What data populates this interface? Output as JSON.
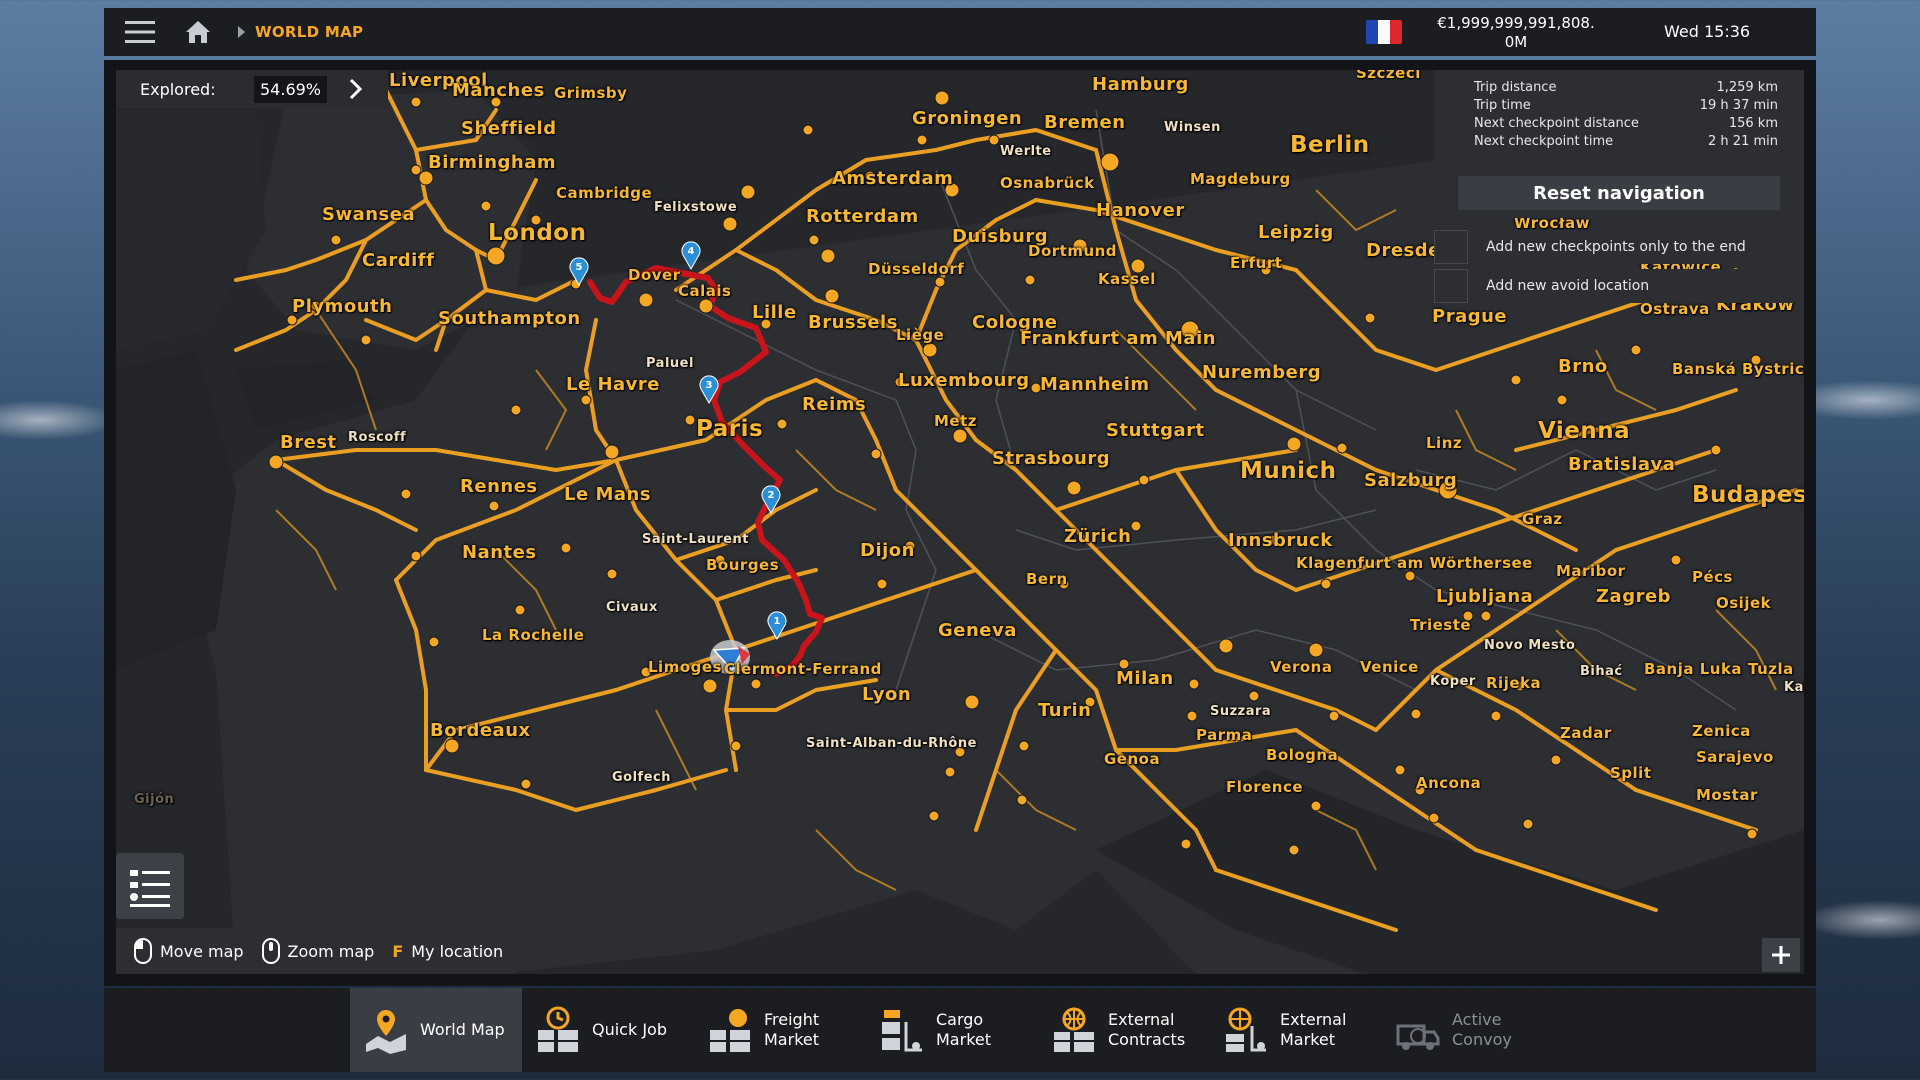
{
  "topbar": {
    "breadcrumb": "WORLD MAP",
    "money_line1": "€1,999,999,991,808.",
    "money_line2": "0M",
    "datetime": "Wed 15:36",
    "flag_colors": [
      "#1f46b4",
      "#ffffff",
      "#e0262f"
    ]
  },
  "explored": {
    "label": "Explored:",
    "value": "54.69%"
  },
  "navigation": {
    "rows": [
      {
        "label": "Trip distance",
        "value": "1,259 km"
      },
      {
        "label": "Trip time",
        "value": "19 h 37 min"
      },
      {
        "label": "Next checkpoint distance",
        "value": "156 km"
      },
      {
        "label": "Next checkpoint time",
        "value": "2 h 21 min"
      }
    ],
    "reset_label": "Reset navigation",
    "option_end": "Add new checkpoints only to the end",
    "option_avoid": "Add new avoid location"
  },
  "controls": {
    "move": "Move map",
    "zoom": "Zoom map",
    "key_f": "F",
    "location": "My location"
  },
  "map": {
    "cities": {
      "liverpool": "Liverpool",
      "manchester": "Manches",
      "grimsby": "Grimsby",
      "sheffield": "Sheffield",
      "birmingham": "Birmingham",
      "cambridge": "Cambridge",
      "felixstowe": "Felixstowe",
      "swansea": "Swansea",
      "london": "London",
      "cardiff": "Cardiff",
      "dover": "Dover",
      "calais": "Calais",
      "plymouth": "Plymouth",
      "southampton": "Southampton",
      "lille": "Lille",
      "brussels": "Brussels",
      "liege": "Liège",
      "paluel": "Paluel",
      "le_havre": "Le Havre",
      "luxembourg": "Luxembourg",
      "reims": "Reims",
      "metz": "Metz",
      "paris": "Paris",
      "brest": "Brest",
      "roscoff": "Roscoff",
      "rennes": "Rennes",
      "le_mans": "Le Mans",
      "saint_laurent": "Saint-Laurent",
      "bourges": "Bourges",
      "dijon": "Dijon",
      "nantes": "Nantes",
      "civaux": "Civaux",
      "la_rochelle": "La Rochelle",
      "limoges": "Limoges",
      "clermont": "Clermont-Ferrand",
      "lyon": "Lyon",
      "geneva": "Geneva",
      "saint_alban": "Saint-Alban-du-Rhône",
      "bordeaux": "Bordeaux",
      "golfech": "Golfech",
      "gijon": "Gijón",
      "hamburg": "Hamburg",
      "groningen": "Groningen",
      "bremen": "Bremen",
      "winsen": "Winsen",
      "berlin": "Berlin",
      "szczecin": "Szczeci",
      "amsterdam": "Amsterdam",
      "werlte": "Werlte",
      "osnabruck": "Osnabrück",
      "magdeburg": "Magdeburg",
      "rotterdam": "Rotterdam",
      "hanover": "Hanover",
      "duisburg": "Duisburg",
      "leipzig": "Leipzig",
      "dusseldorf": "Düsseldorf",
      "dortmund": "Dortmund",
      "dresden": "Dresden",
      "wroclaw": "Wrocław",
      "kassel": "Kassel",
      "erfurt": "Erfurt",
      "katowice": "Katowice",
      "cologne": "Cologne",
      "frankfurt": "Frankfurt am Main",
      "prague": "Prague",
      "ostrava": "Ostrava",
      "krakow": "Kraków",
      "nuremberg": "Nuremberg",
      "mannheim": "Mannheim",
      "brno": "Brno",
      "banska": "Banská Bystrica",
      "stuttgart": "Stuttgart",
      "vienna": "Vienna",
      "strasbourg": "Strasbourg",
      "linz": "Linz",
      "bratislava": "Bratislava",
      "munich": "Munich",
      "salzburg": "Salzburg",
      "budapest": "Budapest",
      "zurich": "Zürich",
      "graz": "Graz",
      "innsbruck": "Innsbruck",
      "klagenfurt": "Klagenfurt am Wörthersee",
      "maribor": "Maribor",
      "pecs": "Pécs",
      "bern": "Bern",
      "ljubljana": "Ljubljana",
      "zagreb": "Zagreb",
      "osijek": "Osijek",
      "trieste": "Trieste",
      "novo_mesto": "Novo Mesto",
      "milan": "Milan",
      "verona": "Verona",
      "venice": "Venice",
      "koper": "Koper",
      "rijeka": "Rijeka",
      "bihac": "Bihać",
      "banja_luka": "Banja Luka",
      "tuzla": "Tuzla",
      "kal": "Kal",
      "turin": "Turin",
      "suzzara": "Suzzara",
      "parma": "Parma",
      "zadar": "Zadar",
      "zenica": "Zenica",
      "bologna": "Bologna",
      "sarajevo": "Sarajevo",
      "genoa": "Genoa",
      "split": "Split",
      "florence": "Florence",
      "ancona": "Ancona",
      "mostar": "Mostar"
    },
    "checkpoints": [
      "1",
      "2",
      "3",
      "4",
      "5"
    ],
    "route_color": "#d11a1a",
    "road_color": "#f5a623"
  },
  "tabs": [
    {
      "label": "World Map",
      "icon": "world-map-icon"
    },
    {
      "label": "Quick Job",
      "icon": "quick-job-icon"
    },
    {
      "label": "Freight\nMarket",
      "line1": "Freight",
      "line2": "Market",
      "icon": "freight-market-icon"
    },
    {
      "line1": "Cargo",
      "line2": "Market",
      "icon": "cargo-market-icon"
    },
    {
      "line1": "External",
      "line2": "Contracts",
      "icon": "external-contracts-icon"
    },
    {
      "line1": "External",
      "line2": "Market",
      "icon": "external-market-icon"
    },
    {
      "line1": "Active",
      "line2": "Convoy",
      "icon": "active-convoy-icon"
    }
  ]
}
